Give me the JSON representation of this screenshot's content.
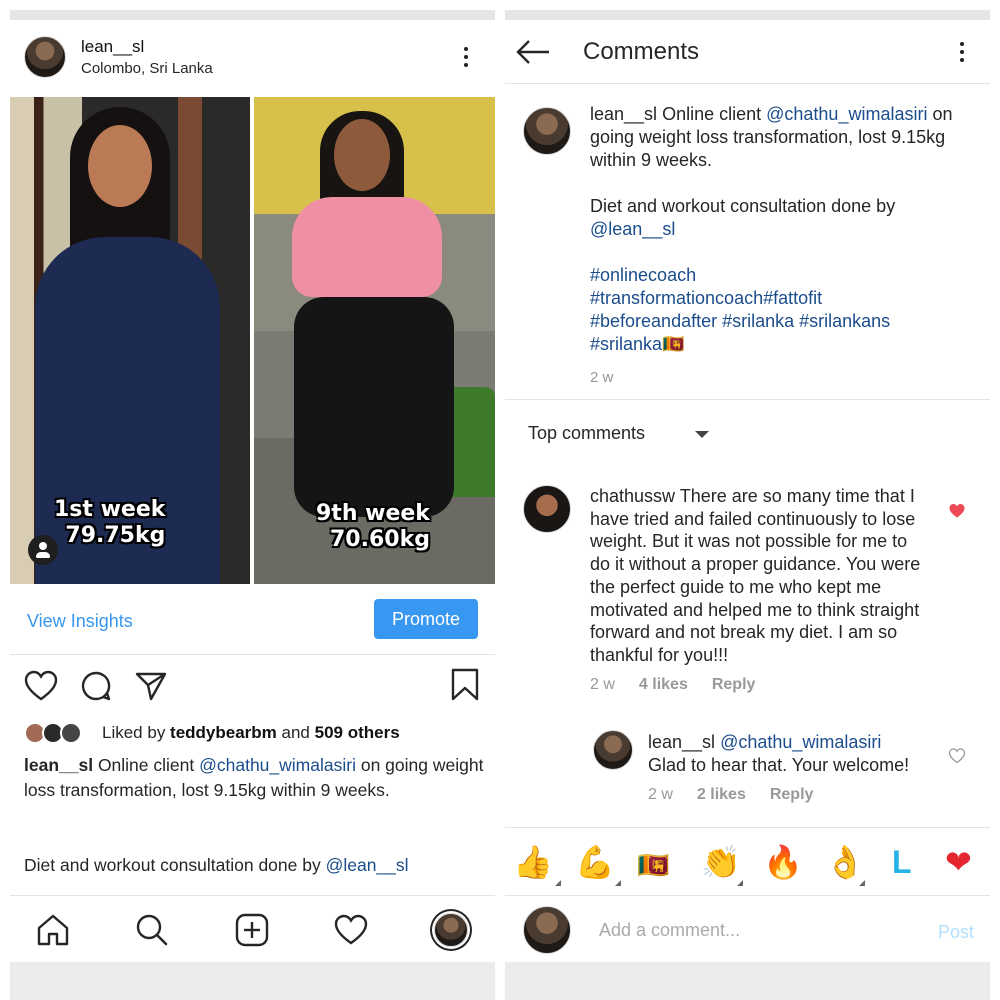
{
  "left": {
    "header": {
      "username": "lean__sl",
      "location": "Colombo, Sri Lanka"
    },
    "photos": {
      "before": {
        "line1": "1st week",
        "line2": "79.75kg"
      },
      "after": {
        "line1": "9th week",
        "line2": "70.60kg"
      }
    },
    "insights": {
      "view_label": "View Insights",
      "promote_label": "Promote"
    },
    "likes": {
      "prefix": "Liked by ",
      "user": "teddybearbm",
      "middle": " and ",
      "count": "509 others"
    },
    "caption": {
      "username": "lean__sl",
      "text1": " Online client ",
      "mention": "@chathu_wimalasiri",
      "text2": " on going weight loss transformation,  lost 9.15kg  within 9 weeks.",
      "diet": "Diet and workout consultation done by ",
      "diet_mention": "@lean__sl"
    }
  },
  "right": {
    "header": {
      "title": "Comments"
    },
    "caption": {
      "username": "lean__sl",
      "text1": " Online client ",
      "mention": "@chathu_wimalasiri",
      "text2": " on going  weight loss transformation,  lost 9.15kg  within 9 weeks.",
      "diet": "Diet and workout consultation done by",
      "diet_mention": "@lean__sl",
      "tags_line1": "#onlinecoach",
      "tags_line2": "#transformationcoach#fattofit",
      "tags_line3": "#beforeandafter #srilanka #srilankans",
      "tags_line4": "#srilanka🇱🇰",
      "time": "2 w"
    },
    "top_comments_label": "Top comments",
    "comment1": {
      "username": "chathussw",
      "text": " There are so many time that I have tried and failed continuously to lose weight. But it was not possible for me to do it without a proper guidance. You were the perfect guide to me who kept me motivated and helped me to think straight forward and not break my diet. I am so thankful for you!!!",
      "time": "2 w",
      "likes": "4 likes",
      "reply": "Reply"
    },
    "comment2": {
      "username": "lean__sl",
      "mention": " @chathu_wimalasiri",
      "text": "Glad to hear that. Your welcome!",
      "time": "2 w",
      "likes": "2 likes",
      "reply": "Reply"
    },
    "emoji_bar": [
      "👍",
      "💪",
      "🇱🇰",
      "👏",
      "🔥",
      "👌",
      "L",
      "❤"
    ],
    "add_comment": {
      "placeholder": "Add a comment...",
      "post_label": "Post"
    }
  },
  "colors": {
    "accent": "#3897f0",
    "link": "#1b4d8c",
    "like_red": "#ed4956",
    "muted": "#999999"
  }
}
